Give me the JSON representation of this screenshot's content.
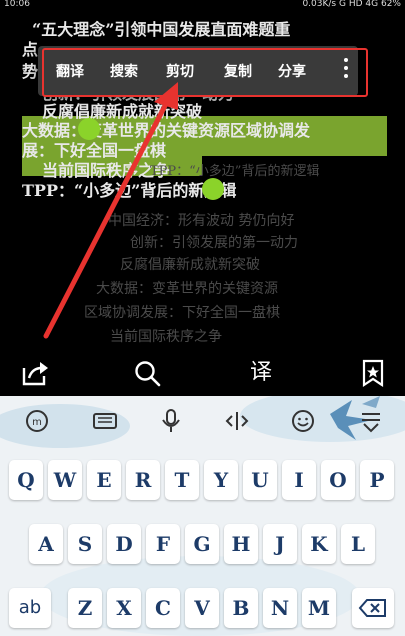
{
  "status": {
    "time": "10:06",
    "speed": "0.03K/s",
    "net": "G HD",
    "net2": "4G",
    "battery": "62%"
  },
  "reader": {
    "lines_dim": [
      "点",
      "势",
      "直面难题重",
      "中国经济：形有波动  势仍向好",
      "创新：引领发展的第一动力",
      "反腐倡廉新成就新突破",
      "大数据：变革世界的关键资源",
      "区域协调发展：下好全国一盘棋",
      "当前国际秩序之争"
    ],
    "line_title": "“五大理念”引领中国发展直面难题重",
    "line_innov": "创新：引领发展的第一动力",
    "line_anti": "反腐倡廉新成就新突破",
    "line_sel1": "大数据：变革世界的关键资源区域协调发",
    "line_sel2": "展：下好全国一盘棋",
    "line_sel3": "当前国际秩序之争",
    "line_tpp": "TPP：“小多边”背后的新逻辑",
    "line_tpp_dim": "TPP：“小多边”背后的新逻辑"
  },
  "popup": {
    "translate": "翻译",
    "search": "搜索",
    "cut": "剪切",
    "copy": "复制",
    "share": "分享"
  },
  "toolbar": {
    "translate_label": "译"
  },
  "keyboard": {
    "row1": [
      "Q",
      "W",
      "E",
      "R",
      "T",
      "Y",
      "U",
      "I",
      "O",
      "P"
    ],
    "row2": [
      "A",
      "S",
      "D",
      "F",
      "G",
      "H",
      "J",
      "K",
      "L"
    ],
    "row3": [
      "Z",
      "X",
      "C",
      "V",
      "B",
      "N",
      "M"
    ],
    "ab_label": "ab",
    "ime_label": "m"
  }
}
